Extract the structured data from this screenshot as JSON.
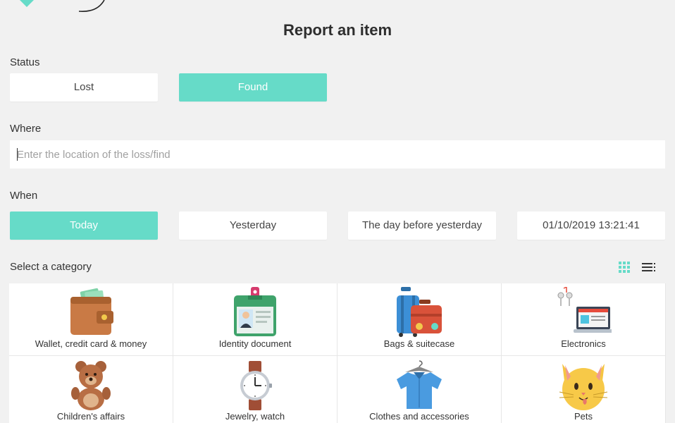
{
  "page": {
    "title": "Report an item"
  },
  "status": {
    "label": "Status",
    "options": [
      "Lost",
      "Found"
    ],
    "selected": "Found"
  },
  "where": {
    "label": "Where",
    "placeholder": "Enter the location of the loss/find",
    "value": ""
  },
  "when": {
    "label": "When",
    "options": [
      "Today",
      "Yesterday",
      "The day before yesterday",
      "01/10/2019 13:21:41"
    ],
    "selected": "Today"
  },
  "category": {
    "label": "Select a category",
    "view_icons": [
      "grid-view-icon",
      "list-view-icon"
    ],
    "items": [
      {
        "label": "Wallet, credit card & money",
        "icon": "wallet-icon"
      },
      {
        "label": "Identity document",
        "icon": "id-card-icon"
      },
      {
        "label": "Bags & suitecase",
        "icon": "luggage-icon"
      },
      {
        "label": "Electronics",
        "icon": "laptop-icon"
      },
      {
        "label": "Children's affairs",
        "icon": "teddy-bear-icon"
      },
      {
        "label": "Jewelry, watch",
        "icon": "watch-icon"
      },
      {
        "label": "Clothes and accessories",
        "icon": "shirt-icon"
      },
      {
        "label": "Pets",
        "icon": "cat-icon"
      }
    ]
  },
  "colors": {
    "accent": "#66dbc8",
    "background": "#f1f1f1",
    "card": "#ffffff"
  }
}
